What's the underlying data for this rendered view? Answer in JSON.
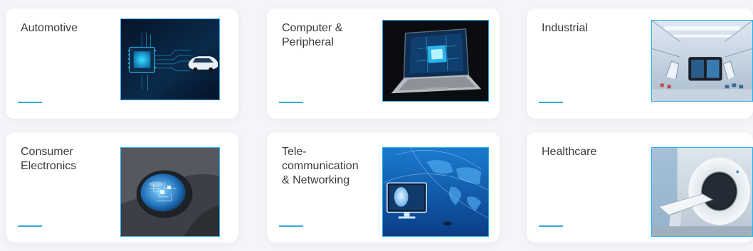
{
  "accent_color": "#3aa8d6",
  "image_border_color": "#2ab0e8",
  "cards": [
    {
      "title": "Automotive",
      "image": "car-chip-image"
    },
    {
      "title": "Computer &\nPeripheral",
      "image": "laptop-chip-image"
    },
    {
      "title": "Industrial",
      "image": "factory-robot-image"
    },
    {
      "title": "Consumer\nElectronics",
      "image": "earbud-circuit-image"
    },
    {
      "title": "Tele-\ncommunication\n& Networking",
      "image": "world-map-monitor-image"
    },
    {
      "title": "Healthcare",
      "image": "mri-scanner-image"
    }
  ]
}
